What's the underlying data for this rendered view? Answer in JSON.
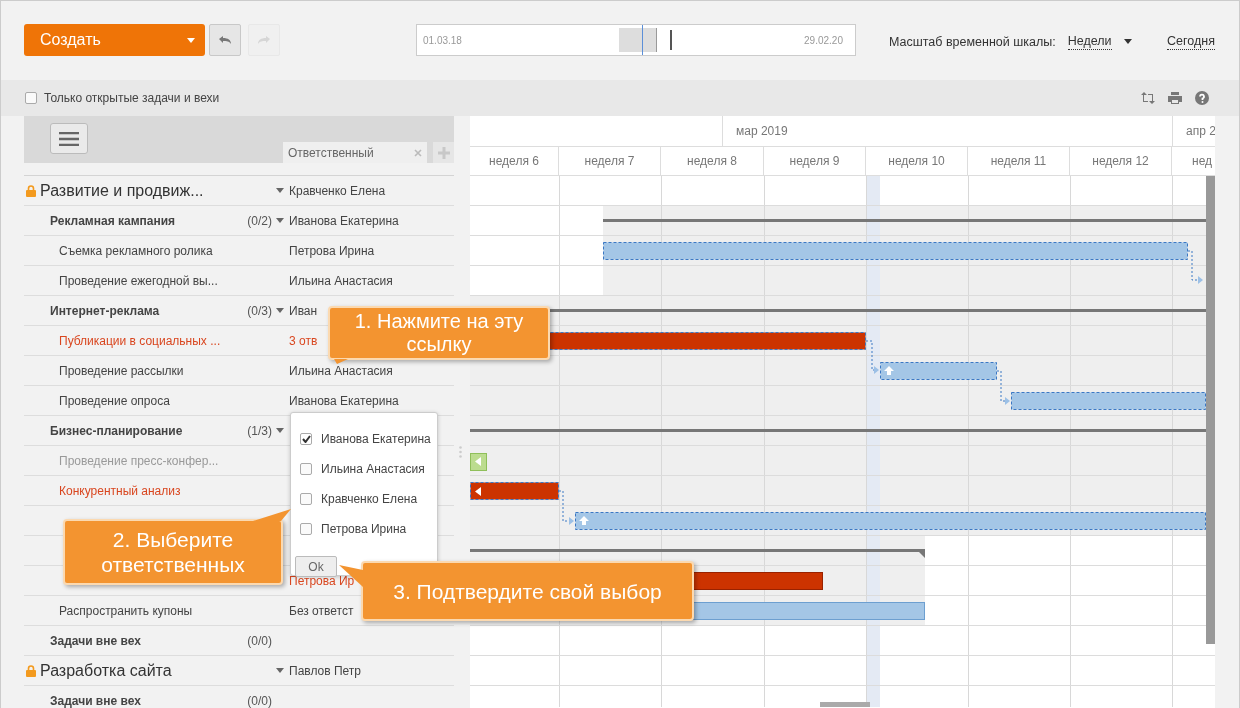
{
  "toolbar": {
    "create_button": "Создать",
    "undo": {
      "disabled": false
    },
    "redo": {
      "disabled": true
    },
    "timeline": {
      "start": "01.03.18",
      "end": "29.02.20"
    },
    "scale_label": "Масштаб временной шкалы:",
    "scale_value": "Недели",
    "today_link": "Сегодня"
  },
  "filter": {
    "label": "Только открытые задачи и вехи",
    "checked": false
  },
  "column_tab": {
    "label": "Ответственный"
  },
  "timeline_header": {
    "months": [
      "мар 2019",
      "апр 2"
    ],
    "weeks": [
      "неделя 6",
      "неделя 7",
      "неделя 8",
      "неделя 9",
      "неделя 10",
      "неделя 11",
      "неделя 12",
      "нед"
    ]
  },
  "rows": [
    {
      "kind": "project",
      "name": "Развитие и продвиж...",
      "responsible": "Кравченко Елена",
      "menu": true
    },
    {
      "kind": "milestone",
      "name": "Рекламная кампания",
      "count": "(0/2)",
      "responsible": "Иванова Екатерина",
      "menu": true
    },
    {
      "kind": "task",
      "name": "Съемка рекламного ролика",
      "responsible": "Петрова Ирина",
      "overdue": false,
      "closed": false
    },
    {
      "kind": "task",
      "name": "Проведение ежегодной вы...",
      "responsible": "Ильина Анастасия",
      "overdue": false,
      "closed": false
    },
    {
      "kind": "milestone",
      "name": "Интернет-реклама",
      "count": "(0/3)",
      "responsible": "Иван",
      "menu": true
    },
    {
      "kind": "task",
      "name": "Публикации в социальных ...",
      "responsible": "3 отв",
      "overdue": true,
      "closed": false
    },
    {
      "kind": "task",
      "name": "Проведение рассылки",
      "responsible": "Ильина Анастасия",
      "overdue": false,
      "closed": false
    },
    {
      "kind": "task",
      "name": "Проведение опроса",
      "responsible": "Иванова Екатерина",
      "overdue": false,
      "closed": false
    },
    {
      "kind": "milestone",
      "name": "Бизнес-планирование",
      "count": "(1/3)",
      "menu": true
    },
    {
      "kind": "task",
      "name": "Проведение пресс-конфер...",
      "overdue": false,
      "closed": true
    },
    {
      "kind": "task",
      "name": "Конкурентный анализ",
      "overdue": true,
      "closed": false
    },
    {
      "kind": "task",
      "overdue": false,
      "closed": false
    },
    {
      "kind": "milestone"
    },
    {
      "kind": "task",
      "responsible": "Петрова Ир",
      "overdue": true,
      "closed": false
    },
    {
      "kind": "task",
      "name": "Распространить купоны",
      "responsible": "Без ответст",
      "overdue": false,
      "closed": false
    },
    {
      "kind": "milestone",
      "name": "Задачи вне вех",
      "count": "(0/0)",
      "menu": false
    },
    {
      "kind": "project",
      "name": "Разработка сайта",
      "responsible": "Павлов Петр",
      "menu": true
    },
    {
      "kind": "milestone",
      "name": "Задачи вне вех",
      "count": "(0/0)",
      "menu": false
    }
  ],
  "assignee_popup": {
    "options": [
      {
        "name": "Иванова Екатерина",
        "checked": true
      },
      {
        "name": "Ильина Анастасия",
        "checked": false
      },
      {
        "name": "Кравченко Елена",
        "checked": false
      },
      {
        "name": "Петрова Ирина",
        "checked": false
      }
    ],
    "ok_button": "Ok"
  },
  "callouts": [
    {
      "text": "1. Нажмите на эту ссылку"
    },
    {
      "text": "2. Выберите ответственных"
    },
    {
      "text": "3. Подтвердите свой выбор"
    }
  ]
}
